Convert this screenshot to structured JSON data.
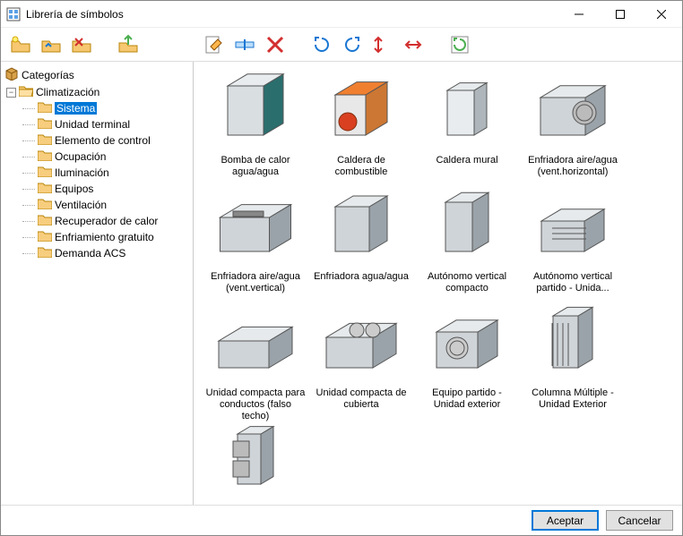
{
  "window": {
    "title": "Librería de símbolos"
  },
  "toolbar": {
    "new_folder": "new-folder",
    "open_folder": "open-folder",
    "delete_folder": "delete-folder",
    "export": "export",
    "edit": "edit",
    "rename": "rename",
    "delete": "delete",
    "rotate_left": "rotate-left",
    "rotate_right": "rotate-right",
    "flip_h": "flip-horizontal",
    "flip_v": "flip-vertical",
    "refresh": "refresh"
  },
  "tree": {
    "root": "Categorías",
    "category": "Climatización",
    "items": [
      "Sistema",
      "Unidad terminal",
      "Elemento de control",
      "Ocupación",
      "Iluminación",
      "Equipos",
      "Ventilación",
      "Recuperador de calor",
      "Enfriamiento gratuito",
      "Demanda ACS"
    ],
    "selected_index": 0
  },
  "grid": {
    "items": [
      {
        "label": "Bomba de calor agua/agua"
      },
      {
        "label": "Caldera de combustible"
      },
      {
        "label": "Caldera mural"
      },
      {
        "label": "Enfriadora aire/agua (vent.horizontal)"
      },
      {
        "label": "Enfriadora aire/agua (vent.vertical)"
      },
      {
        "label": "Enfriadora agua/agua"
      },
      {
        "label": "Autónomo vertical compacto"
      },
      {
        "label": "Autónomo vertical partido - Unida..."
      },
      {
        "label": "Unidad compacta para conductos (falso techo)"
      },
      {
        "label": "Unidad compacta de cubierta"
      },
      {
        "label": "Equipo partido - Unidad exterior"
      },
      {
        "label": "Columna Múltiple - Unidad Exterior"
      },
      {
        "label": ""
      }
    ]
  },
  "footer": {
    "accept": "Aceptar",
    "cancel": "Cancelar"
  }
}
